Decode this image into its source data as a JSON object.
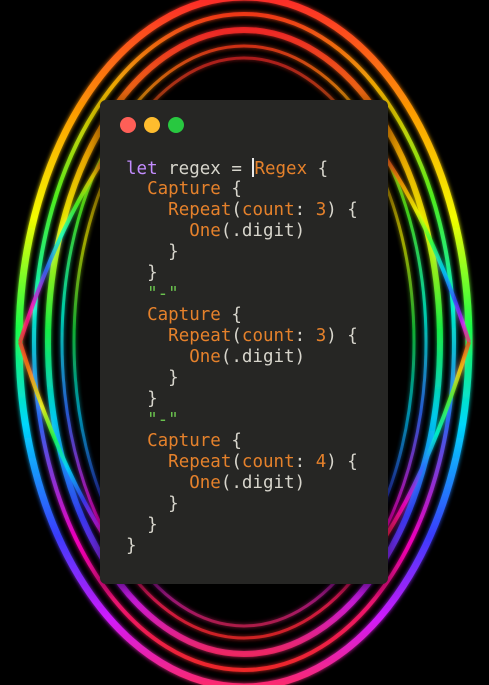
{
  "colors": {
    "window_bg": "#262624",
    "dot_close": "#fe5f57",
    "dot_minimize": "#febc2e",
    "dot_maximize": "#28c840",
    "plain": "#d7d5cc",
    "keyword": "#c38cff",
    "type": "#e5812b",
    "number": "#e5812b",
    "string": "#6ac24e"
  },
  "window_controls": [
    "close-dot",
    "minimize-dot",
    "maximize-dot"
  ],
  "code_lines": [
    {
      "indent": "",
      "tokens": [
        {
          "t": "let",
          "c": "keyword"
        },
        {
          "t": " regex = ",
          "c": "plain"
        },
        {
          "cursor": true
        },
        {
          "t": "Regex",
          "c": "type"
        },
        {
          "t": " {",
          "c": "plain"
        }
      ]
    },
    {
      "indent": "  ",
      "tokens": [
        {
          "t": "Capture",
          "c": "type"
        },
        {
          "t": " {",
          "c": "plain"
        }
      ]
    },
    {
      "indent": "    ",
      "tokens": [
        {
          "t": "Repeat",
          "c": "type"
        },
        {
          "t": "(",
          "c": "plain"
        },
        {
          "t": "count",
          "c": "type"
        },
        {
          "t": ": ",
          "c": "plain"
        },
        {
          "t": "3",
          "c": "number"
        },
        {
          "t": ") {",
          "c": "plain"
        }
      ]
    },
    {
      "indent": "      ",
      "tokens": [
        {
          "t": "One",
          "c": "type"
        },
        {
          "t": "(.digit)",
          "c": "plain"
        }
      ]
    },
    {
      "indent": "    ",
      "tokens": [
        {
          "t": "}",
          "c": "plain"
        }
      ]
    },
    {
      "indent": "  ",
      "tokens": [
        {
          "t": "}",
          "c": "plain"
        }
      ]
    },
    {
      "indent": "  ",
      "tokens": [
        {
          "t": "\"-\"",
          "c": "string"
        }
      ]
    },
    {
      "indent": "  ",
      "tokens": [
        {
          "t": "Capture",
          "c": "type"
        },
        {
          "t": " {",
          "c": "plain"
        }
      ]
    },
    {
      "indent": "    ",
      "tokens": [
        {
          "t": "Repeat",
          "c": "type"
        },
        {
          "t": "(",
          "c": "plain"
        },
        {
          "t": "count",
          "c": "type"
        },
        {
          "t": ": ",
          "c": "plain"
        },
        {
          "t": "3",
          "c": "number"
        },
        {
          "t": ") {",
          "c": "plain"
        }
      ]
    },
    {
      "indent": "      ",
      "tokens": [
        {
          "t": "One",
          "c": "type"
        },
        {
          "t": "(.digit)",
          "c": "plain"
        }
      ]
    },
    {
      "indent": "    ",
      "tokens": [
        {
          "t": "}",
          "c": "plain"
        }
      ]
    },
    {
      "indent": "  ",
      "tokens": [
        {
          "t": "}",
          "c": "plain"
        }
      ]
    },
    {
      "indent": "  ",
      "tokens": [
        {
          "t": "\"-\"",
          "c": "string"
        }
      ]
    },
    {
      "indent": "  ",
      "tokens": [
        {
          "t": "Capture",
          "c": "type"
        },
        {
          "t": " {",
          "c": "plain"
        }
      ]
    },
    {
      "indent": "    ",
      "tokens": [
        {
          "t": "Repeat",
          "c": "type"
        },
        {
          "t": "(",
          "c": "plain"
        },
        {
          "t": "count",
          "c": "type"
        },
        {
          "t": ": ",
          "c": "plain"
        },
        {
          "t": "4",
          "c": "number"
        },
        {
          "t": ") {",
          "c": "plain"
        }
      ]
    },
    {
      "indent": "      ",
      "tokens": [
        {
          "t": "One",
          "c": "type"
        },
        {
          "t": "(.digit)",
          "c": "plain"
        }
      ]
    },
    {
      "indent": "    ",
      "tokens": [
        {
          "t": "}",
          "c": "plain"
        }
      ]
    },
    {
      "indent": "  ",
      "tokens": [
        {
          "t": "}",
          "c": "plain"
        }
      ]
    },
    {
      "indent": "",
      "tokens": [
        {
          "t": "}",
          "c": "plain"
        }
      ]
    }
  ]
}
